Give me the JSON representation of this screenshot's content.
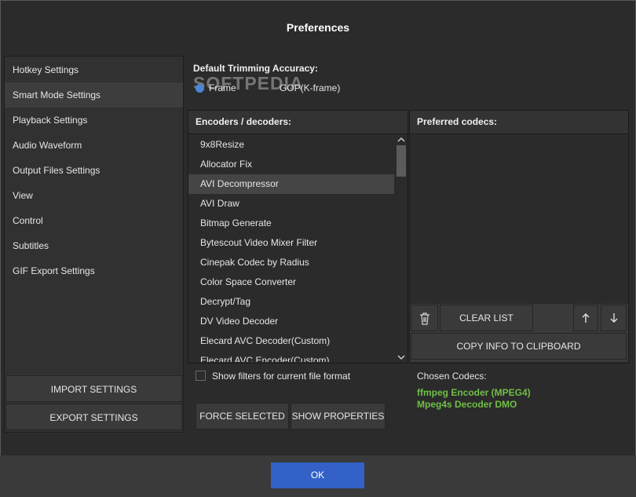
{
  "dialog": {
    "title": "Preferences"
  },
  "sidebar": {
    "items": [
      {
        "label": "Hotkey Settings"
      },
      {
        "label": "Smart Mode Settings"
      },
      {
        "label": "Playback Settings"
      },
      {
        "label": "Audio Waveform"
      },
      {
        "label": "Output Files Settings"
      },
      {
        "label": "View"
      },
      {
        "label": "Control"
      },
      {
        "label": "Subtitles"
      },
      {
        "label": "GIF Export Settings"
      }
    ],
    "active_index": 1,
    "import_label": "IMPORT SETTINGS",
    "export_label": "EXPORT SETTINGS"
  },
  "trimming": {
    "label": "Default Trimming Accuracy:",
    "option_frame": "Frame",
    "option_gop": "GOP(K-frame)",
    "selected": "Frame"
  },
  "watermark": "SOFTPEDIA",
  "encoders": {
    "header": "Encoders / decoders:",
    "items": [
      "9x8Resize",
      "Allocator Fix",
      "AVI Decompressor",
      "AVI Draw",
      "Bitmap Generate",
      "Bytescout Video Mixer Filter",
      "Cinepak Codec by Radius",
      "Color Space Converter",
      "Decrypt/Tag",
      "DV Video Decoder",
      "Elecard AVC Decoder(Custom)",
      "Elecard AVC Encoder(Custom)"
    ],
    "selected_index": 2,
    "show_filters_label": "Show filters for current file format",
    "force_selected_label": "FORCE SELECTED",
    "show_properties_label": "SHOW PROPERTIES"
  },
  "preferred": {
    "header": "Preferred codecs:",
    "clear_list_label": "CLEAR LIST",
    "copy_info_label": "COPY INFO TO CLIPBOARD"
  },
  "chosen": {
    "label": "Chosen Codecs:",
    "codecs": [
      "ffmpeg Encoder (MPEG4)",
      "Mpeg4s Decoder DMO"
    ]
  },
  "footer": {
    "ok_label": "OK"
  },
  "colors": {
    "background": "#2b2b2b",
    "accent": "#3361c8",
    "codec_green": "#6fbf45"
  }
}
